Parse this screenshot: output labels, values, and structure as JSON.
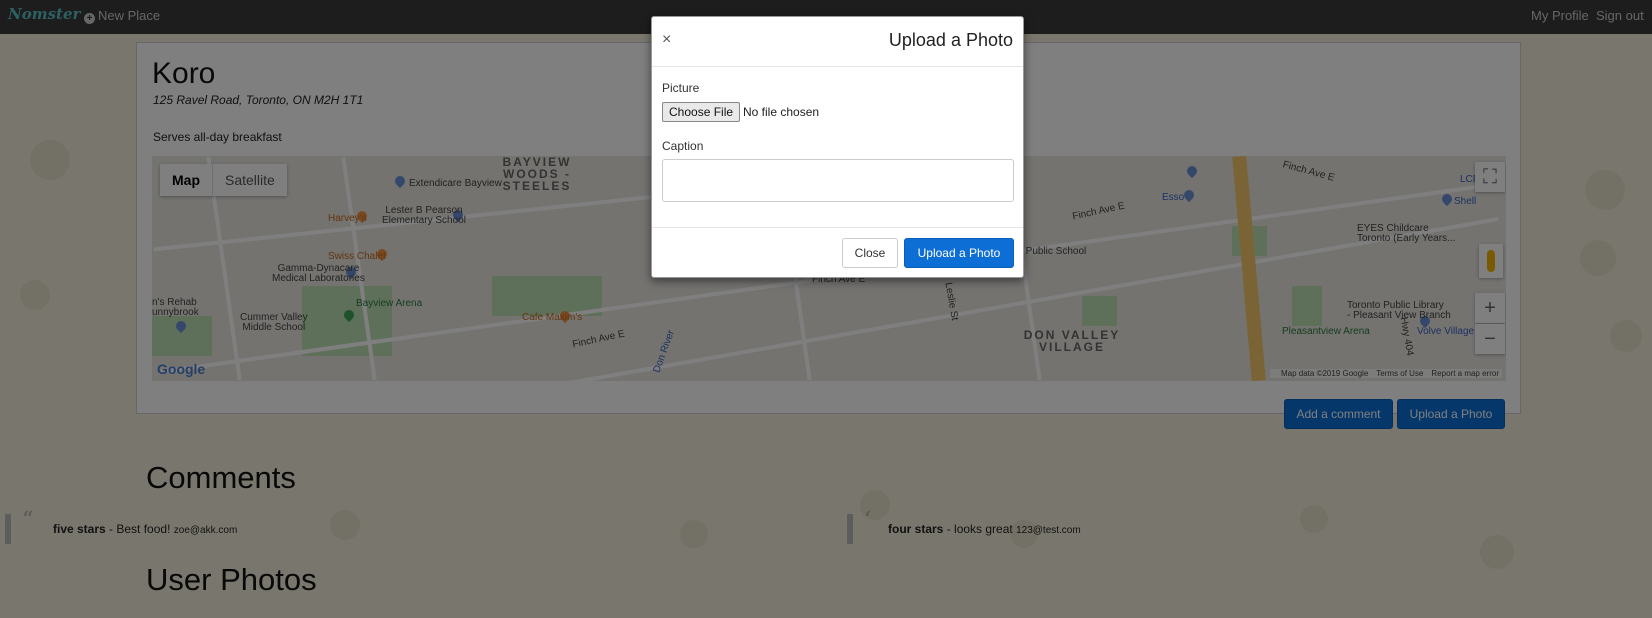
{
  "navbar": {
    "brand": "Nomster",
    "new_place": "New Place",
    "my_profile": "My Profile",
    "sign_out": "Sign out"
  },
  "place": {
    "name": "Koro",
    "address": "125 Ravel Road, Toronto, ON M2H 1T1",
    "description": "Serves all-day breakfast"
  },
  "map": {
    "type_map": "Map",
    "type_satellite": "Satellite",
    "google": "Google",
    "footer_data": "Map data ©2019 Google",
    "footer_terms": "Terms of Use",
    "footer_report": "Report a map error",
    "area_bayview_woods": "BAYVIEW\nWOODS -\nSTEELES",
    "area_don_valley": "DON VALLEY\nVILLAGE",
    "labels": {
      "extendicare": "Extendicare Bayview",
      "lester": "Lester B Pearson\nElementary School",
      "harveys": "Harvey's",
      "swiss_chalet": "Swiss Chalet",
      "gamma": "Gamma-Dynacare\nMedical Laboratories",
      "bayview_arena": "Bayview Arena",
      "cummer": "Cummer Valley\nMiddle School",
      "cafe_maxims": "Cafe Maxim's",
      "finch_ave_e": "Finch Ave E",
      "eyes_childcare": "EYES Childcare\nToronto (Early Years...",
      "library": "Toronto Public Library\n- Pleasant View Branch",
      "pleasantview_arena": "Pleasantview Arena",
      "volve_village": "Volve Village",
      "hill_school": "Hill Public School",
      "hwy": "Hwy 404",
      "shell": "Shell",
      "lcbo": "LCB",
      "esso": "Esso",
      "rehab": "n's Rehab\nunnybrook",
      "don_river": "Don River",
      "leslie": "Leslie St"
    }
  },
  "actions": {
    "add_comment": "Add a comment",
    "upload_photo": "Upload a Photo"
  },
  "comments": {
    "title": "Comments",
    "items": [
      {
        "rating": "five stars",
        "text": "Best food!",
        "email": "zoe@akk.com"
      },
      {
        "rating": "four stars",
        "text": "looks great",
        "email": "123@test.com"
      }
    ]
  },
  "user_photos": {
    "title": "User Photos"
  },
  "modal": {
    "close_x": "×",
    "title": "Upload a Photo",
    "picture_label": "Picture",
    "choose_file": "Choose File",
    "file_status": "No file chosen",
    "caption_label": "Caption",
    "caption_value": "",
    "close_button": "Close",
    "submit_button": "Upload a Photo"
  },
  "colors": {
    "primary": "#0d6ed6",
    "navbar": "#3a3a3a",
    "brand": "#5cc0c7",
    "page_bg": "#f3efdb"
  }
}
